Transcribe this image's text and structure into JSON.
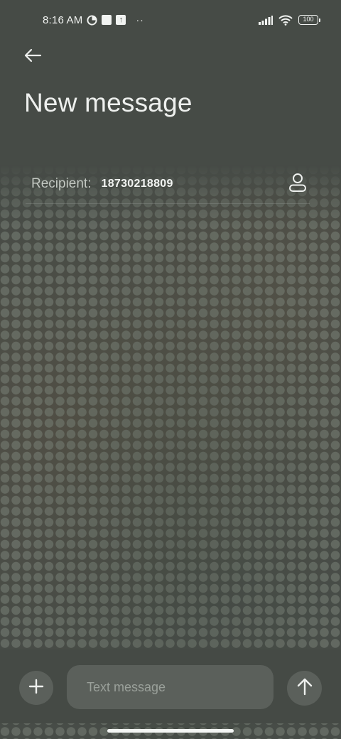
{
  "status_bar": {
    "time": "8:16 AM",
    "icons": [
      "data-saver-icon",
      "square-notification-icon",
      "upload-icon",
      "more-dots-icon"
    ],
    "dots": "··",
    "battery_level": "100"
  },
  "header": {
    "back_icon": "arrow-left-icon",
    "title": "New message"
  },
  "recipient": {
    "label": "Recipient:",
    "value": "18730218809",
    "contact_icon": "person-icon"
  },
  "compose": {
    "attach_icon": "plus-icon",
    "placeholder": "Text message",
    "value": "",
    "send_icon": "arrow-up-icon"
  }
}
